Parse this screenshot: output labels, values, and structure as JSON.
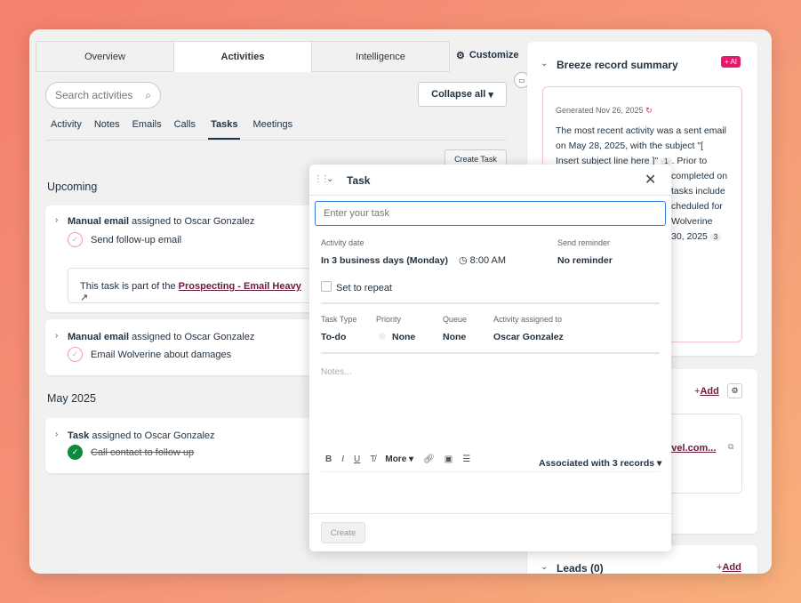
{
  "tabs": [
    "Overview",
    "Activities",
    "Intelligence"
  ],
  "customize": "Customize",
  "search": {
    "placeholder": "Search activities"
  },
  "collapse_all": "Collapse all",
  "subtabs": [
    "Activity",
    "Notes",
    "Emails",
    "Calls",
    "Tasks",
    "Meetings"
  ],
  "create_task": "Create Task",
  "sections": [
    {
      "title": "Upcoming",
      "items": [
        {
          "type": "Manual email",
          "assigned": "assigned to Oscar Gonzalez",
          "task": "Send follow-up email",
          "note": "This task is part of the",
          "note_link": "Prospecting - Email Heavy"
        },
        {
          "type": "Manual email",
          "assigned": "assigned to Oscar Gonzalez",
          "task": "Email Wolverine about damages"
        }
      ]
    },
    {
      "title": "May 2025",
      "items": [
        {
          "type": "Task",
          "assigned": "assigned to Oscar Gonzalez",
          "task": "Call contact to follow up",
          "done": true
        }
      ]
    }
  ],
  "modal": {
    "title": "Task",
    "input_placeholder": "Enter your task",
    "activity_date_label": "Activity date",
    "activity_date": "In 3 business days (Monday)",
    "time": "8:00 AM",
    "reminder_label": "Send reminder",
    "reminder": "No reminder",
    "repeat": "Set to repeat",
    "task_type_label": "Task Type",
    "task_type": "To-do",
    "priority_label": "Priority",
    "priority": "None",
    "queue_label": "Queue",
    "queue": "None",
    "assigned_label": "Activity assigned to",
    "assigned": "Oscar Gonzalez",
    "notes_placeholder": "Notes...",
    "more": "More",
    "associated": "Associated with 3 records",
    "create": "Create"
  },
  "summary": {
    "title": "Breeze record summary",
    "ai_badge": "+ AI",
    "generated": "Generated Nov 26, 2025",
    "lines": [
      "The most recent activity was a sent email",
      "on May 28, 2025, with the subject \"[",
      "Insert subject line here ]\""
    ],
    "ref1": "1",
    "after1": ". Prior to",
    "hidden_lines": [
      "completed on",
      "tasks include",
      "cheduled for",
      "Wolverine",
      "30, 2025"
    ],
    "ref3": "3"
  },
  "contacts": {
    "add": "Add",
    "email_partial": "rvel.com..."
  },
  "leads": {
    "title": "Leads (0)",
    "add": "Add"
  }
}
